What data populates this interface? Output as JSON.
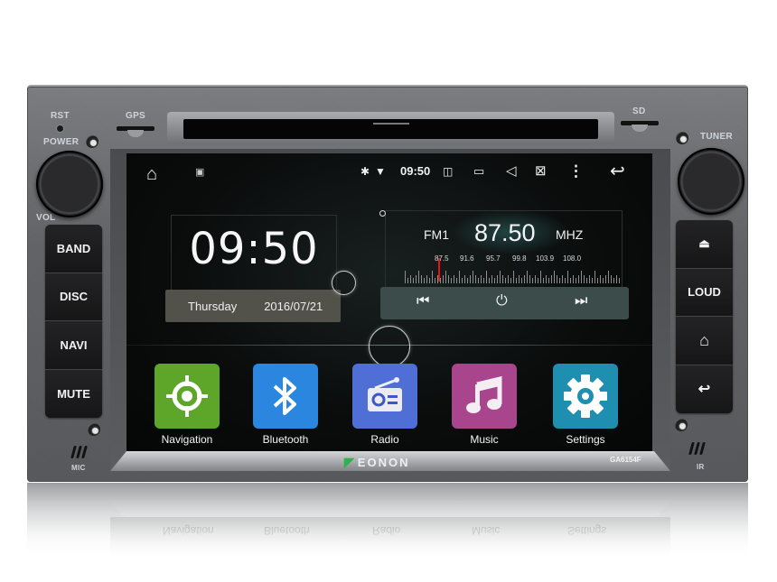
{
  "device": {
    "brand": "EONON",
    "model": "GA6154F",
    "panel_labels": {
      "rst": "RST",
      "gps": "GPS",
      "power": "POWER",
      "vol": "VOL",
      "sd": "SD",
      "tuner": "TUNER",
      "mic": "MIC",
      "ir": "IR"
    },
    "left_buttons": [
      {
        "label": "BAND"
      },
      {
        "label": "DISC"
      },
      {
        "label": "NAVI"
      },
      {
        "label": "MUTE"
      }
    ],
    "right_buttons": [
      {
        "label": "",
        "icon": "eject-icon",
        "glyph": "⏏"
      },
      {
        "label": "LOUD"
      },
      {
        "label": "",
        "icon": "home-icon",
        "glyph": "⌂"
      },
      {
        "label": "",
        "icon": "back-icon",
        "glyph": "↩"
      }
    ]
  },
  "statusbar": {
    "time": "09:50",
    "icons": {
      "home": "⌂",
      "gallery": "▣",
      "bluetooth": "✱",
      "wifi": "▼",
      "screenshot": "◫",
      "recents": "▭",
      "volume": "◁",
      "close_app": "⊠",
      "menu": "⋮",
      "back": "↩"
    }
  },
  "clock_widget": {
    "time": "09:50",
    "day": "Thursday",
    "date": "2016/07/21"
  },
  "radio_widget": {
    "band": "FM1",
    "frequency": "87.50",
    "unit": "MHZ",
    "scale_labels": [
      "87.5",
      "91.6",
      "95.7",
      "99.8",
      "103.9",
      "108.0"
    ],
    "controls": {
      "prev": "⏮",
      "power": "⏻",
      "next": "⏭"
    }
  },
  "apps": [
    {
      "label": "Navigation",
      "color": "#5da62a",
      "icon": "crosshair-icon"
    },
    {
      "label": "Bluetooth",
      "color": "#2a86de",
      "icon": "bluetooth-icon"
    },
    {
      "label": "Radio",
      "color": "#4f6fd6",
      "icon": "radio-icon"
    },
    {
      "label": "Music",
      "color": "#a8458d",
      "icon": "music-note-icon"
    },
    {
      "label": "Settings",
      "color": "#1e8fb0",
      "icon": "gear-icon"
    }
  ]
}
